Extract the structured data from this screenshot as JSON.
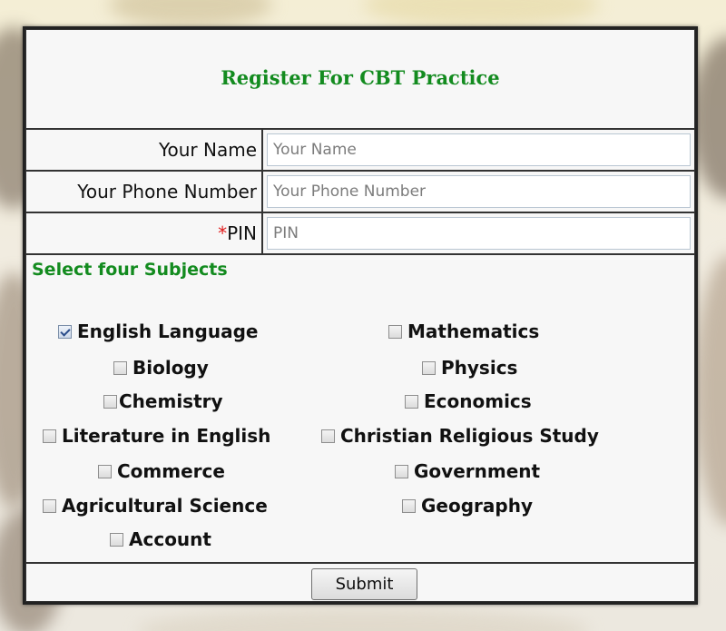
{
  "form": {
    "title": "Register For CBT Practice",
    "fields": {
      "name": {
        "label": "Your Name",
        "placeholder": "Your Name"
      },
      "phone": {
        "label": "Your Phone Number",
        "placeholder": "Your Phone Number"
      },
      "pin": {
        "required_mark": "*",
        "label": "PIN",
        "placeholder": "PIN"
      }
    },
    "subjects_heading": "Select four Subjects",
    "subjects": [
      {
        "label": "English Language",
        "checked": true
      },
      {
        "label": "Mathematics",
        "checked": false
      },
      {
        "label": "Biology",
        "checked": false
      },
      {
        "label": "Physics",
        "checked": false
      },
      {
        "label": "Chemistry",
        "checked": false
      },
      {
        "label": "Economics",
        "checked": false
      },
      {
        "label": "Literature in English",
        "checked": false
      },
      {
        "label": "Christian Religious Study",
        "checked": false
      },
      {
        "label": "Commerce",
        "checked": false
      },
      {
        "label": "Government",
        "checked": false
      },
      {
        "label": "Agricultural Science",
        "checked": false
      },
      {
        "label": "Geography",
        "checked": false
      },
      {
        "label": "Account",
        "checked": false
      }
    ],
    "submit_label": "Submit"
  },
  "colors": {
    "heading_green": "#138b1f",
    "required_red": "#e01a1a",
    "border_dark": "#222222"
  }
}
